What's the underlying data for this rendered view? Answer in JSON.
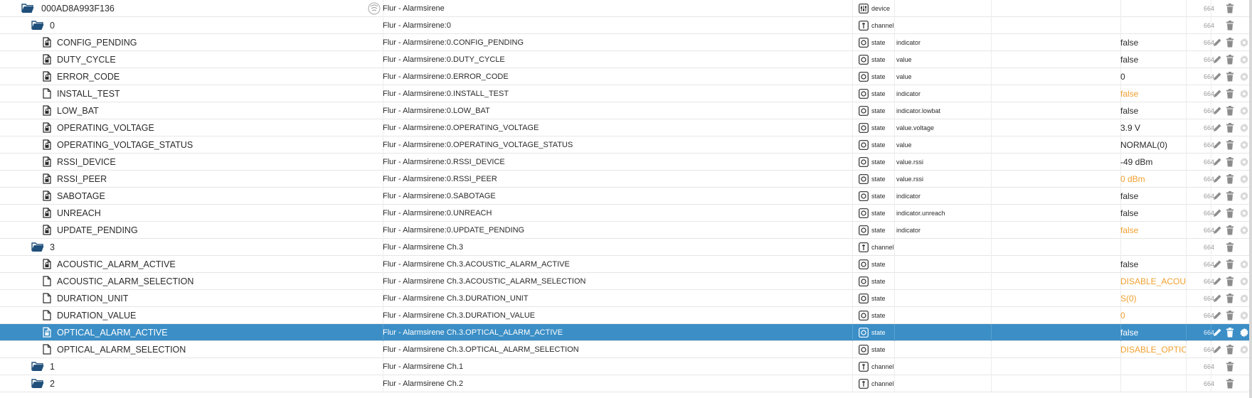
{
  "rows": [
    {
      "level": 0,
      "kind": "folder",
      "id": "000AD8A993F136",
      "name": "Flur - Alarmsirene",
      "type": "device",
      "role": "",
      "value": "",
      "valueColor": "",
      "acl": "664",
      "actions": "del",
      "hasDeviceLogo": true
    },
    {
      "level": 1,
      "kind": "folder",
      "id": "0",
      "name": "Flur - Alarmsirene:0",
      "type": "channel",
      "role": "",
      "value": "",
      "valueColor": "",
      "acl": "664",
      "actions": "del"
    },
    {
      "level": 2,
      "kind": "file-lock",
      "id": "CONFIG_PENDING",
      "name": "Flur - Alarmsirene:0.CONFIG_PENDING",
      "type": "state",
      "role": "indicator",
      "value": "false",
      "valueColor": "",
      "acl": "664",
      "actions": "all"
    },
    {
      "level": 2,
      "kind": "file-lock",
      "id": "DUTY_CYCLE",
      "name": "Flur - Alarmsirene:0.DUTY_CYCLE",
      "type": "state",
      "role": "value",
      "value": "false",
      "valueColor": "",
      "acl": "664",
      "actions": "all"
    },
    {
      "level": 2,
      "kind": "file-lock",
      "id": "ERROR_CODE",
      "name": "Flur - Alarmsirene:0.ERROR_CODE",
      "type": "state",
      "role": "value",
      "value": "0",
      "valueColor": "",
      "acl": "664",
      "actions": "all"
    },
    {
      "level": 2,
      "kind": "file",
      "id": "INSTALL_TEST",
      "name": "Flur - Alarmsirene:0.INSTALL_TEST",
      "type": "state",
      "role": "indicator",
      "value": "false",
      "valueColor": "orange",
      "acl": "664",
      "actions": "all"
    },
    {
      "level": 2,
      "kind": "file-lock",
      "id": "LOW_BAT",
      "name": "Flur - Alarmsirene:0.LOW_BAT",
      "type": "state",
      "role": "indicator.lowbat",
      "value": "false",
      "valueColor": "",
      "acl": "664",
      "actions": "all"
    },
    {
      "level": 2,
      "kind": "file-lock",
      "id": "OPERATING_VOLTAGE",
      "name": "Flur - Alarmsirene:0.OPERATING_VOLTAGE",
      "type": "state",
      "role": "value.voltage",
      "value": "3.9 V",
      "valueColor": "",
      "acl": "664",
      "actions": "all"
    },
    {
      "level": 2,
      "kind": "file-lock",
      "id": "OPERATING_VOLTAGE_STATUS",
      "name": "Flur - Alarmsirene:0.OPERATING_VOLTAGE_STATUS",
      "type": "state",
      "role": "value",
      "value": "NORMAL(0)",
      "valueColor": "",
      "acl": "664",
      "actions": "all"
    },
    {
      "level": 2,
      "kind": "file-lock",
      "id": "RSSI_DEVICE",
      "name": "Flur - Alarmsirene:0.RSSI_DEVICE",
      "type": "state",
      "role": "value.rssi",
      "value": "-49 dBm",
      "valueColor": "",
      "acl": "664",
      "actions": "all"
    },
    {
      "level": 2,
      "kind": "file-lock",
      "id": "RSSI_PEER",
      "name": "Flur - Alarmsirene:0.RSSI_PEER",
      "type": "state",
      "role": "value.rssi",
      "value": "0 dBm",
      "valueColor": "orange",
      "acl": "664",
      "actions": "all"
    },
    {
      "level": 2,
      "kind": "file-lock",
      "id": "SABOTAGE",
      "name": "Flur - Alarmsirene:0.SABOTAGE",
      "type": "state",
      "role": "indicator",
      "value": "false",
      "valueColor": "",
      "acl": "664",
      "actions": "all"
    },
    {
      "level": 2,
      "kind": "file-lock",
      "id": "UNREACH",
      "name": "Flur - Alarmsirene:0.UNREACH",
      "type": "state",
      "role": "indicator.unreach",
      "value": "false",
      "valueColor": "",
      "acl": "664",
      "actions": "all"
    },
    {
      "level": 2,
      "kind": "file-lock",
      "id": "UPDATE_PENDING",
      "name": "Flur - Alarmsirene:0.UPDATE_PENDING",
      "type": "state",
      "role": "indicator",
      "value": "false",
      "valueColor": "orange",
      "acl": "664",
      "actions": "all"
    },
    {
      "level": 1,
      "kind": "folder",
      "id": "3",
      "name": "Flur - Alarmsirene Ch.3",
      "type": "channel",
      "role": "",
      "value": "",
      "valueColor": "",
      "acl": "664",
      "actions": "del"
    },
    {
      "level": 2,
      "kind": "file-lock",
      "id": "ACOUSTIC_ALARM_ACTIVE",
      "name": "Flur - Alarmsirene Ch.3.ACOUSTIC_ALARM_ACTIVE",
      "type": "state",
      "role": "",
      "value": "false",
      "valueColor": "",
      "acl": "664",
      "actions": "all"
    },
    {
      "level": 2,
      "kind": "file",
      "id": "ACOUSTIC_ALARM_SELECTION",
      "name": "Flur - Alarmsirene Ch.3.ACOUSTIC_ALARM_SELECTION",
      "type": "state",
      "role": "",
      "value": "DISABLE_ACOU...",
      "valueColor": "orange",
      "acl": "664",
      "actions": "all"
    },
    {
      "level": 2,
      "kind": "file",
      "id": "DURATION_UNIT",
      "name": "Flur - Alarmsirene Ch.3.DURATION_UNIT",
      "type": "state",
      "role": "",
      "value": "S(0)",
      "valueColor": "orange",
      "acl": "664",
      "actions": "all"
    },
    {
      "level": 2,
      "kind": "file",
      "id": "DURATION_VALUE",
      "name": "Flur - Alarmsirene Ch.3.DURATION_VALUE",
      "type": "state",
      "role": "",
      "value": "0",
      "valueColor": "orange",
      "acl": "664",
      "actions": "all"
    },
    {
      "level": 2,
      "kind": "file-lock",
      "id": "OPTICAL_ALARM_ACTIVE",
      "name": "Flur - Alarmsirene Ch.3.OPTICAL_ALARM_ACTIVE",
      "type": "state",
      "role": "",
      "value": "false",
      "valueColor": "",
      "acl": "664",
      "actions": "all",
      "selected": true
    },
    {
      "level": 2,
      "kind": "file",
      "id": "OPTICAL_ALARM_SELECTION",
      "name": "Flur - Alarmsirene Ch.3.OPTICAL_ALARM_SELECTION",
      "type": "state",
      "role": "",
      "value": "DISABLE_OPTIC...",
      "valueColor": "orange",
      "acl": "664",
      "actions": "all"
    },
    {
      "level": 1,
      "kind": "folder",
      "id": "1",
      "name": "Flur - Alarmsirene Ch.1",
      "type": "channel",
      "role": "",
      "value": "",
      "valueColor": "",
      "acl": "664",
      "actions": "del"
    },
    {
      "level": 1,
      "kind": "folder",
      "id": "2",
      "name": "Flur - Alarmsirene Ch.2",
      "type": "channel",
      "role": "",
      "value": "",
      "valueColor": "",
      "acl": "664",
      "actions": "del"
    }
  ],
  "colors": {
    "selected_bg": "#3b8ec6",
    "icon": "#2b2b2b",
    "folder": "#1f4f7a",
    "orange": "#f0a030"
  }
}
